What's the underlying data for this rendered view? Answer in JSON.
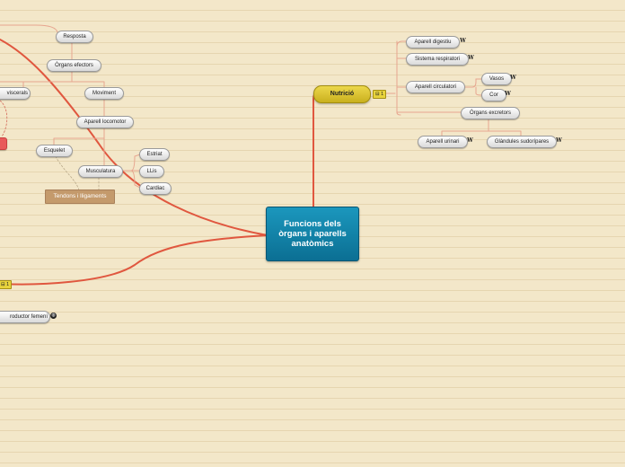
{
  "central": {
    "label": "Funcions dels òrgans i aparells anatòmics"
  },
  "nutricio": {
    "label": "Nutrició",
    "badge": "1",
    "children": {
      "aparell_digestiu": "Aparell digestiu",
      "sistema_respiratori": "Sistema respiratori",
      "aparell_circulatori": "Aparell circulatori",
      "vasos": "Vasos",
      "cor": "Cor",
      "organs_excretors": "Òrgans excretors",
      "aparell_urinari": "Aparell urinari",
      "glandules_sudoripares": "Glàndules sudorípares"
    }
  },
  "relacio": {
    "resposta": "Resposta",
    "organs_efectors": "Òrgans efectors",
    "viscerals": "viscerals",
    "moviment": "Moviment",
    "aparell_locomotor": "Aparell locomotor",
    "esquelet": "Esquelet",
    "musculatura": "Musculatura",
    "estriat": "Estriat",
    "llis": "LLis",
    "cardiac": "Cardiac",
    "tendons": "Tendons i lligaments"
  },
  "reproduccio": {
    "badge": "1",
    "aparell_femeni": "roductor femení"
  },
  "icons": {
    "wiki": "W",
    "note": "⊟",
    "link": "globe-icon"
  },
  "colors": {
    "link_line": "#e0573f",
    "thin_line": "#e7a58f",
    "central_bg": "#1282a8",
    "hub_bg": "#dcc62f",
    "paper": "#f3e7c9"
  }
}
